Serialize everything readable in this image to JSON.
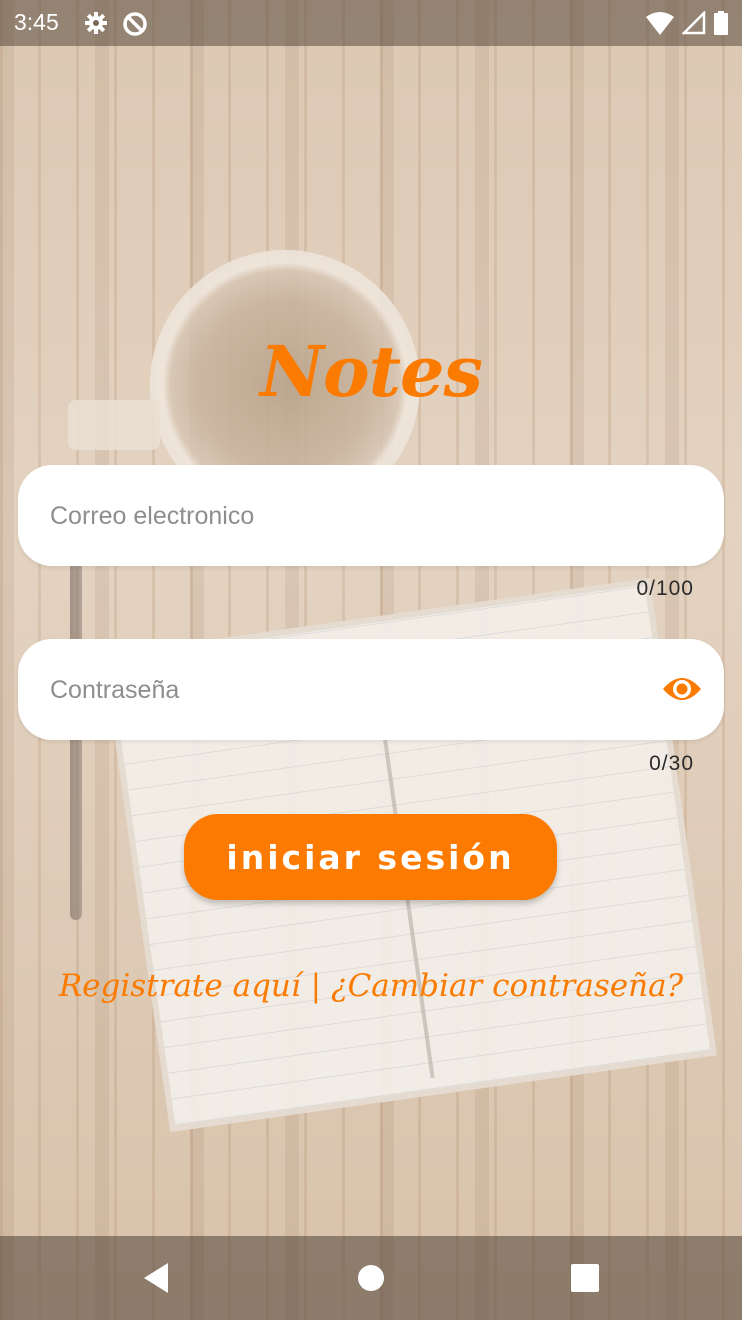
{
  "status_bar": {
    "time": "3:45",
    "icons": [
      "gear-icon",
      "sync-icon",
      "wifi-icon",
      "signal-icon",
      "battery-icon"
    ]
  },
  "app": {
    "logo_text": "Notes",
    "accent_color": "#fb7a00"
  },
  "form": {
    "email": {
      "placeholder": "Correo electronico",
      "value": "",
      "counter": "0/100"
    },
    "password": {
      "placeholder": "Contraseña",
      "value": "",
      "counter": "0/30",
      "toggle_icon": "eye-icon"
    },
    "submit_label": "iniciar sesión"
  },
  "links": {
    "register": "Registrate aquí",
    "separator": "|",
    "change_password": "¿Cambiar contraseña?"
  },
  "nav_bar": {
    "icons": [
      "back-icon",
      "home-icon",
      "recents-icon"
    ]
  }
}
